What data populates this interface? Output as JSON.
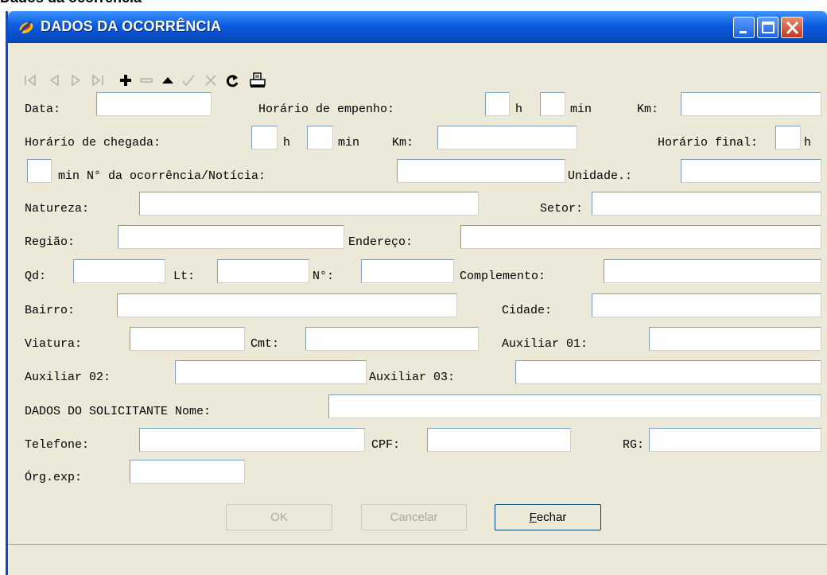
{
  "page_caption": "Dados da ocorrência",
  "window": {
    "title": "DADOS DA OCORRÊNCIA"
  },
  "fields": {
    "data": "Data:",
    "horario_empenho": "Horário de empenho:",
    "h": "h",
    "min": "min",
    "km": "Km:",
    "horario_chegada": "Horário de chegada:",
    "horario_final": "Horário final:",
    "min_ocorrencia": "min N° da ocorrência/Notícia:",
    "unidade": "Unidade.:",
    "natureza": "Natureza:",
    "setor": "Setor:",
    "regiao": "Região:",
    "endereco": "Endereço:",
    "qd": "Qd:",
    "lt": "Lt:",
    "numero": "N°:",
    "complemento": "Complemento:",
    "bairro": "Bairro:",
    "cidade": "Cidade:",
    "viatura": "Viatura:",
    "cmt": "Cmt:",
    "auxiliar01": "Auxiliar 01:",
    "auxiliar02": "Auxiliar 02:",
    "auxiliar03": "Auxiliar 03:",
    "solicitante_nome": "DADOS DO SOLICITANTE Nome:",
    "telefone": "Telefone:",
    "cpf": "CPF:",
    "rg": "RG:",
    "org_exp": "Órg.exp:"
  },
  "buttons": {
    "ok": "OK",
    "cancelar": "Cancelar",
    "fechar_hotkey": "F",
    "fechar_rest": "echar"
  },
  "icons": [
    "first-record-icon",
    "prior-record-icon",
    "next-record-icon",
    "last-record-icon",
    "insert-icon",
    "delete-icon",
    "edit-icon",
    "post-icon",
    "cancel-edit-icon",
    "refresh-icon",
    "print-icon"
  ],
  "colors": {
    "titlebar": "#0a4bc8",
    "window_bg": "#ece9d8",
    "close_button": "#c0391d"
  }
}
